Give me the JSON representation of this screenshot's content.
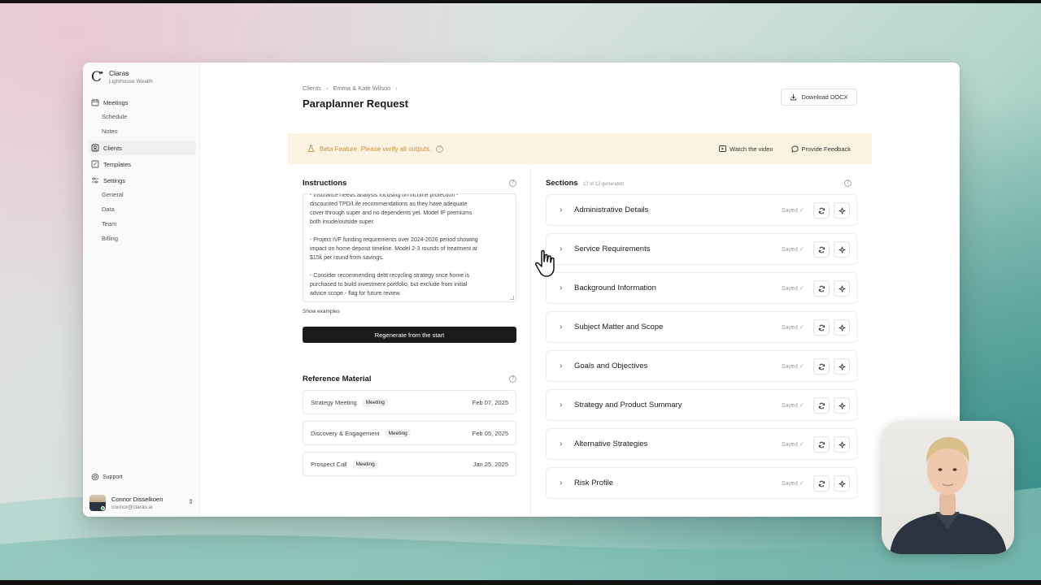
{
  "app": {
    "name": "Claras",
    "org": "Lighthouse Wealth"
  },
  "sidebar": {
    "items": [
      {
        "label": "Meetings",
        "icon": "calendar-icon"
      },
      {
        "label": "Schedule"
      },
      {
        "label": "Notes"
      },
      {
        "label": "Clients",
        "icon": "contact-icon"
      },
      {
        "label": "Templates",
        "icon": "template-icon"
      },
      {
        "label": "Settings",
        "icon": "sliders-icon"
      },
      {
        "label": "General"
      },
      {
        "label": "Data"
      },
      {
        "label": "Team"
      },
      {
        "label": "Billing"
      }
    ],
    "support": "Support",
    "user": {
      "name": "Connor Disselkoen",
      "email": "connor@claras.ai"
    }
  },
  "header": {
    "breadcrumb": [
      "Clients",
      "Emma & Kate Wilson"
    ],
    "title": "Paraplanner Request",
    "download_label": "Download DOCX"
  },
  "beta": {
    "text": "Beta Feature. Please verify all outputs.",
    "watch_video": "Watch the video",
    "feedback": "Provide Feedback",
    "accent": "#c7913c",
    "background": "#fdf3e3"
  },
  "instructions": {
    "title": "Instructions",
    "paragraphs": [
      "- Insurance needs analysis focusing on income protection -\ndiscounted TPD/Life recommendations as they have adequate\ncover through super and no dependents yet. Model IP premiums\nboth inside/outside super.",
      "- Project IVF funding requirements over 2024-2026 period showing\nimpact on home deposit timeline. Model 2-3 rounds of treatment at\n$15k per round from savings.",
      "- Consider recommending debt recycling strategy once home is\npurchased to build investment portfolio, but exclude from initial\nadvice scope - flag for future review."
    ],
    "show_examples": "Show examples",
    "regenerate_label": "Regenerate from the start"
  },
  "reference": {
    "title": "Reference Material",
    "items": [
      {
        "name": "Strategy Meeting",
        "badge": "Meeting",
        "date": "Feb 07, 2025"
      },
      {
        "name": "Discovery & Engagement",
        "badge": "Meeting",
        "date": "Feb 05, 2025"
      },
      {
        "name": "Prospect Call",
        "badge": "Meeting",
        "date": "Jan 25, 2025"
      }
    ]
  },
  "sections": {
    "title": "Sections",
    "count": "12 of 12 generated",
    "saved_label": "Saved",
    "items": [
      "Administrative Details",
      "Service Requirements",
      "Background Information",
      "Subject Matter and Scope",
      "Goals and Objectives",
      "Strategy and Product Summary",
      "Alternative Strategies",
      "Risk Profile"
    ]
  }
}
